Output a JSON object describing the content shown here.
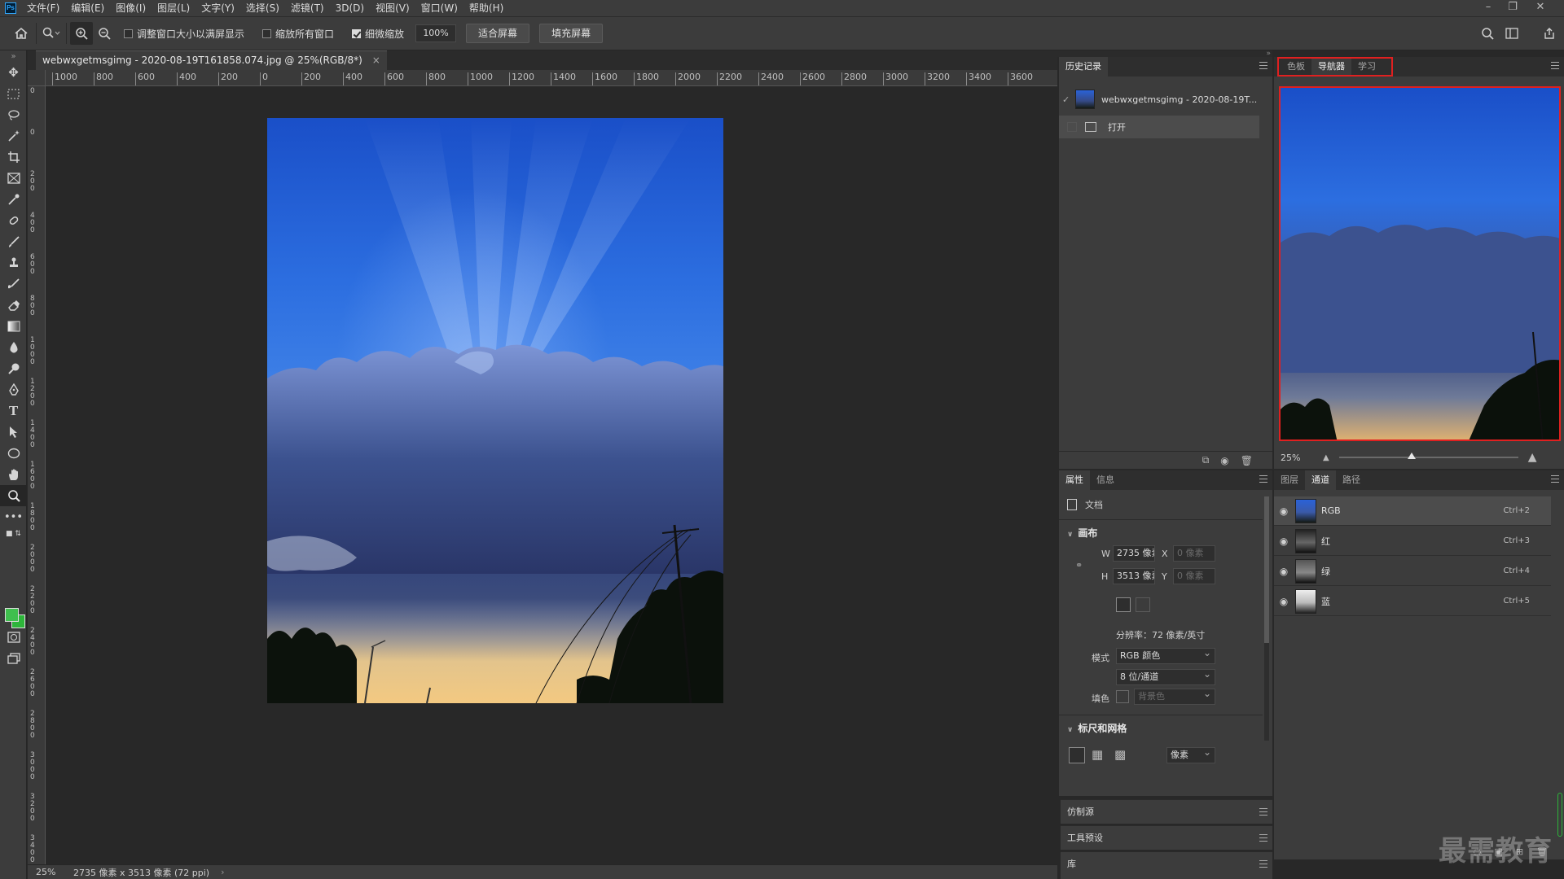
{
  "app": {
    "logo": "Ps"
  },
  "menu": [
    "文件(F)",
    "编辑(E)",
    "图像(I)",
    "图层(L)",
    "文字(Y)",
    "选择(S)",
    "滤镜(T)",
    "3D(D)",
    "视图(V)",
    "窗口(W)",
    "帮助(H)"
  ],
  "options": {
    "resize_windows": "调整窗口大小以满屏显示",
    "zoom_all": "缩放所有窗口",
    "scrubby_zoom": "细微缩放",
    "zoom_value": "100%",
    "fit_screen": "适合屏幕",
    "fill_screen": "填充屏幕"
  },
  "document": {
    "tab_title": "webwxgetmsgimg - 2020-08-19T161858.074.jpg @ 25%(RGB/8*)",
    "zoom": "25%",
    "size_info": "2735 像素 x 3513 像素 (72 ppi)"
  },
  "ruler": {
    "h_labels": [
      "1000",
      "800",
      "600",
      "400",
      "200",
      "0",
      "200",
      "400",
      "600",
      "800",
      "1000",
      "1200",
      "1400",
      "1600",
      "1800",
      "2000",
      "2200",
      "2400",
      "2600",
      "2800",
      "3000",
      "3200",
      "3400",
      "3600"
    ],
    "v_labels": [
      "0",
      "0",
      "200",
      "400",
      "600",
      "800",
      "1000",
      "1200",
      "1400",
      "1600",
      "1800",
      "2000",
      "2200",
      "2400",
      "2600",
      "2800",
      "3000",
      "3200",
      "3400"
    ]
  },
  "history": {
    "tab": "历史记录",
    "snapshot_label": "webwxgetmsgimg - 2020-08-19T...",
    "steps": [
      "打开"
    ]
  },
  "navigator": {
    "tabs": [
      "色板",
      "导航器",
      "学习"
    ],
    "active_tab": "导航器",
    "zoom": "25%",
    "highlight_color": "#e02020"
  },
  "properties": {
    "tabs": [
      "属性",
      "信息"
    ],
    "doc_label": "文档",
    "canvas_title": "画布",
    "w_label": "W",
    "w_value": "2735 像素",
    "h_label": "H",
    "h_value": "3513 像素",
    "x_label": "X",
    "x_value": "0 像素",
    "y_label": "Y",
    "y_value": "0 像素",
    "resolution": "分辨率：72 像素/英寸",
    "mode_label": "模式",
    "mode_value": "RGB 颜色",
    "depth_value": "8 位/通道",
    "fill_label": "填色",
    "fill_value": "背景色",
    "rulers_title": "标尺和网格",
    "unit_value": "像素"
  },
  "channels": {
    "tabs": [
      "图层",
      "通道",
      "路径"
    ],
    "active_tab": "通道",
    "rows": [
      {
        "name": "RGB",
        "shortcut": "Ctrl+2"
      },
      {
        "name": "红",
        "shortcut": "Ctrl+3"
      },
      {
        "name": "绿",
        "shortcut": "Ctrl+4"
      },
      {
        "name": "蓝",
        "shortcut": "Ctrl+5"
      }
    ]
  },
  "collapsed_panels": [
    "仿制源",
    "工具预设",
    "库"
  ],
  "watermark": "最需教育",
  "colors": {
    "foreground": "#3fbf4e",
    "background": "#2db53a",
    "accent": "#e02020"
  }
}
